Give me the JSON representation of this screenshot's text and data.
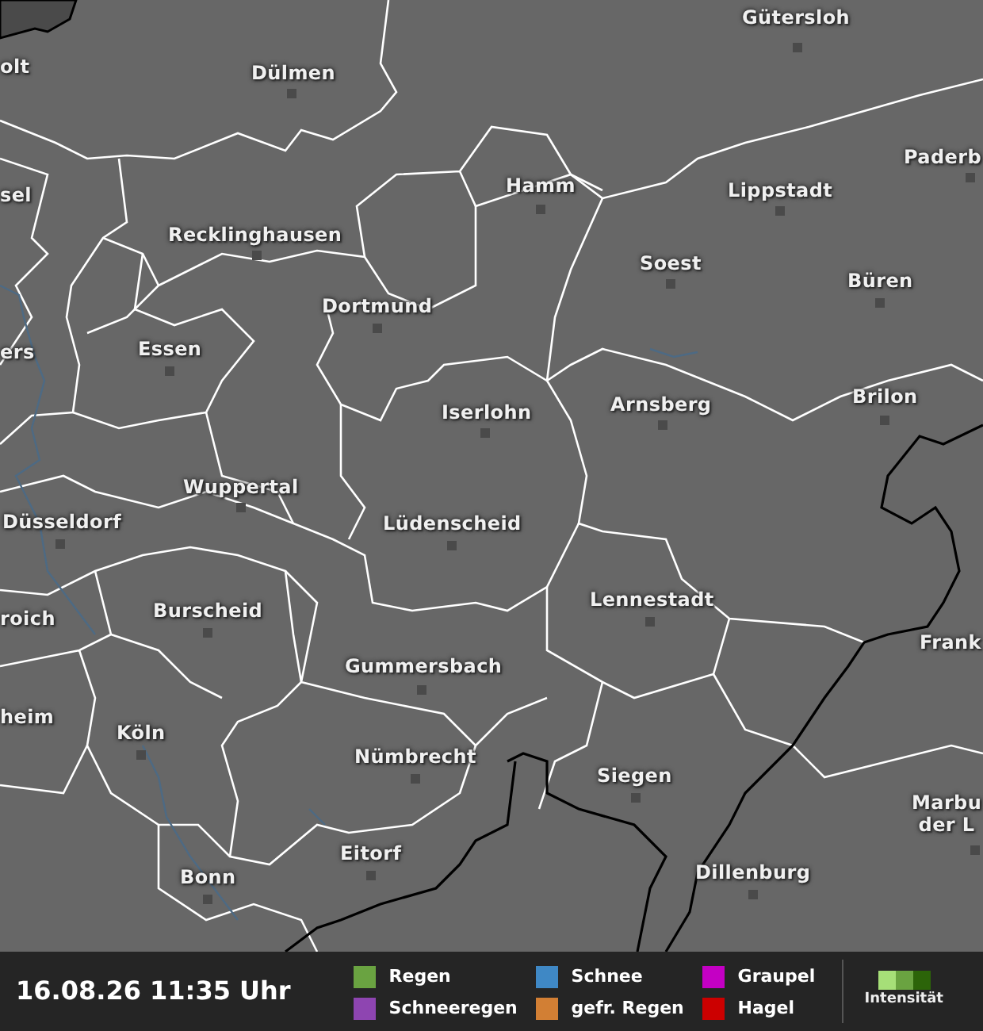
{
  "map": {
    "cities": [
      {
        "name": "Gütersloh"
      },
      {
        "name": "olt"
      },
      {
        "name": "Dülmen"
      },
      {
        "name": "sel"
      },
      {
        "name": "Hamm"
      },
      {
        "name": "Lippstadt"
      },
      {
        "name": "Paderb"
      },
      {
        "name": "Recklinghausen"
      },
      {
        "name": "Soest"
      },
      {
        "name": "Büren"
      },
      {
        "name": "Dortmund"
      },
      {
        "name": "ers"
      },
      {
        "name": "Essen"
      },
      {
        "name": "Brilon"
      },
      {
        "name": "Iserlohn"
      },
      {
        "name": "Arnsberg"
      },
      {
        "name": "Wuppertal"
      },
      {
        "name": "Düsseldorf"
      },
      {
        "name": "Lüdenscheid"
      },
      {
        "name": "Lennestadt"
      },
      {
        "name": "Burscheid"
      },
      {
        "name": "roich"
      },
      {
        "name": "Frank"
      },
      {
        "name": "Gummersbach"
      },
      {
        "name": "heim"
      },
      {
        "name": "Köln"
      },
      {
        "name": "Nümbrecht"
      },
      {
        "name": "Siegen"
      },
      {
        "name": "Marbu\nder L"
      },
      {
        "name": "Bonn"
      },
      {
        "name": "Eitorf"
      },
      {
        "name": "Dillenburg"
      }
    ]
  },
  "footer": {
    "timestamp": "16.08.26 11:35 Uhr",
    "legend": [
      {
        "label": "Regen",
        "color": "#6aa341"
      },
      {
        "label": "Schnee",
        "color": "#3f88c5"
      },
      {
        "label": "Graupel",
        "color": "#c400c4"
      },
      {
        "label": "Schneeregen",
        "color": "#8e45b1"
      },
      {
        "label": "gefr. Regen",
        "color": "#d27f34"
      },
      {
        "label": "Hagel",
        "color": "#cc0000"
      }
    ],
    "intensity": {
      "label": "Intensität",
      "swatches": [
        {
          "color": "#a6df78"
        },
        {
          "color": "#6aa341"
        },
        {
          "color": "#2c6409"
        }
      ]
    }
  }
}
